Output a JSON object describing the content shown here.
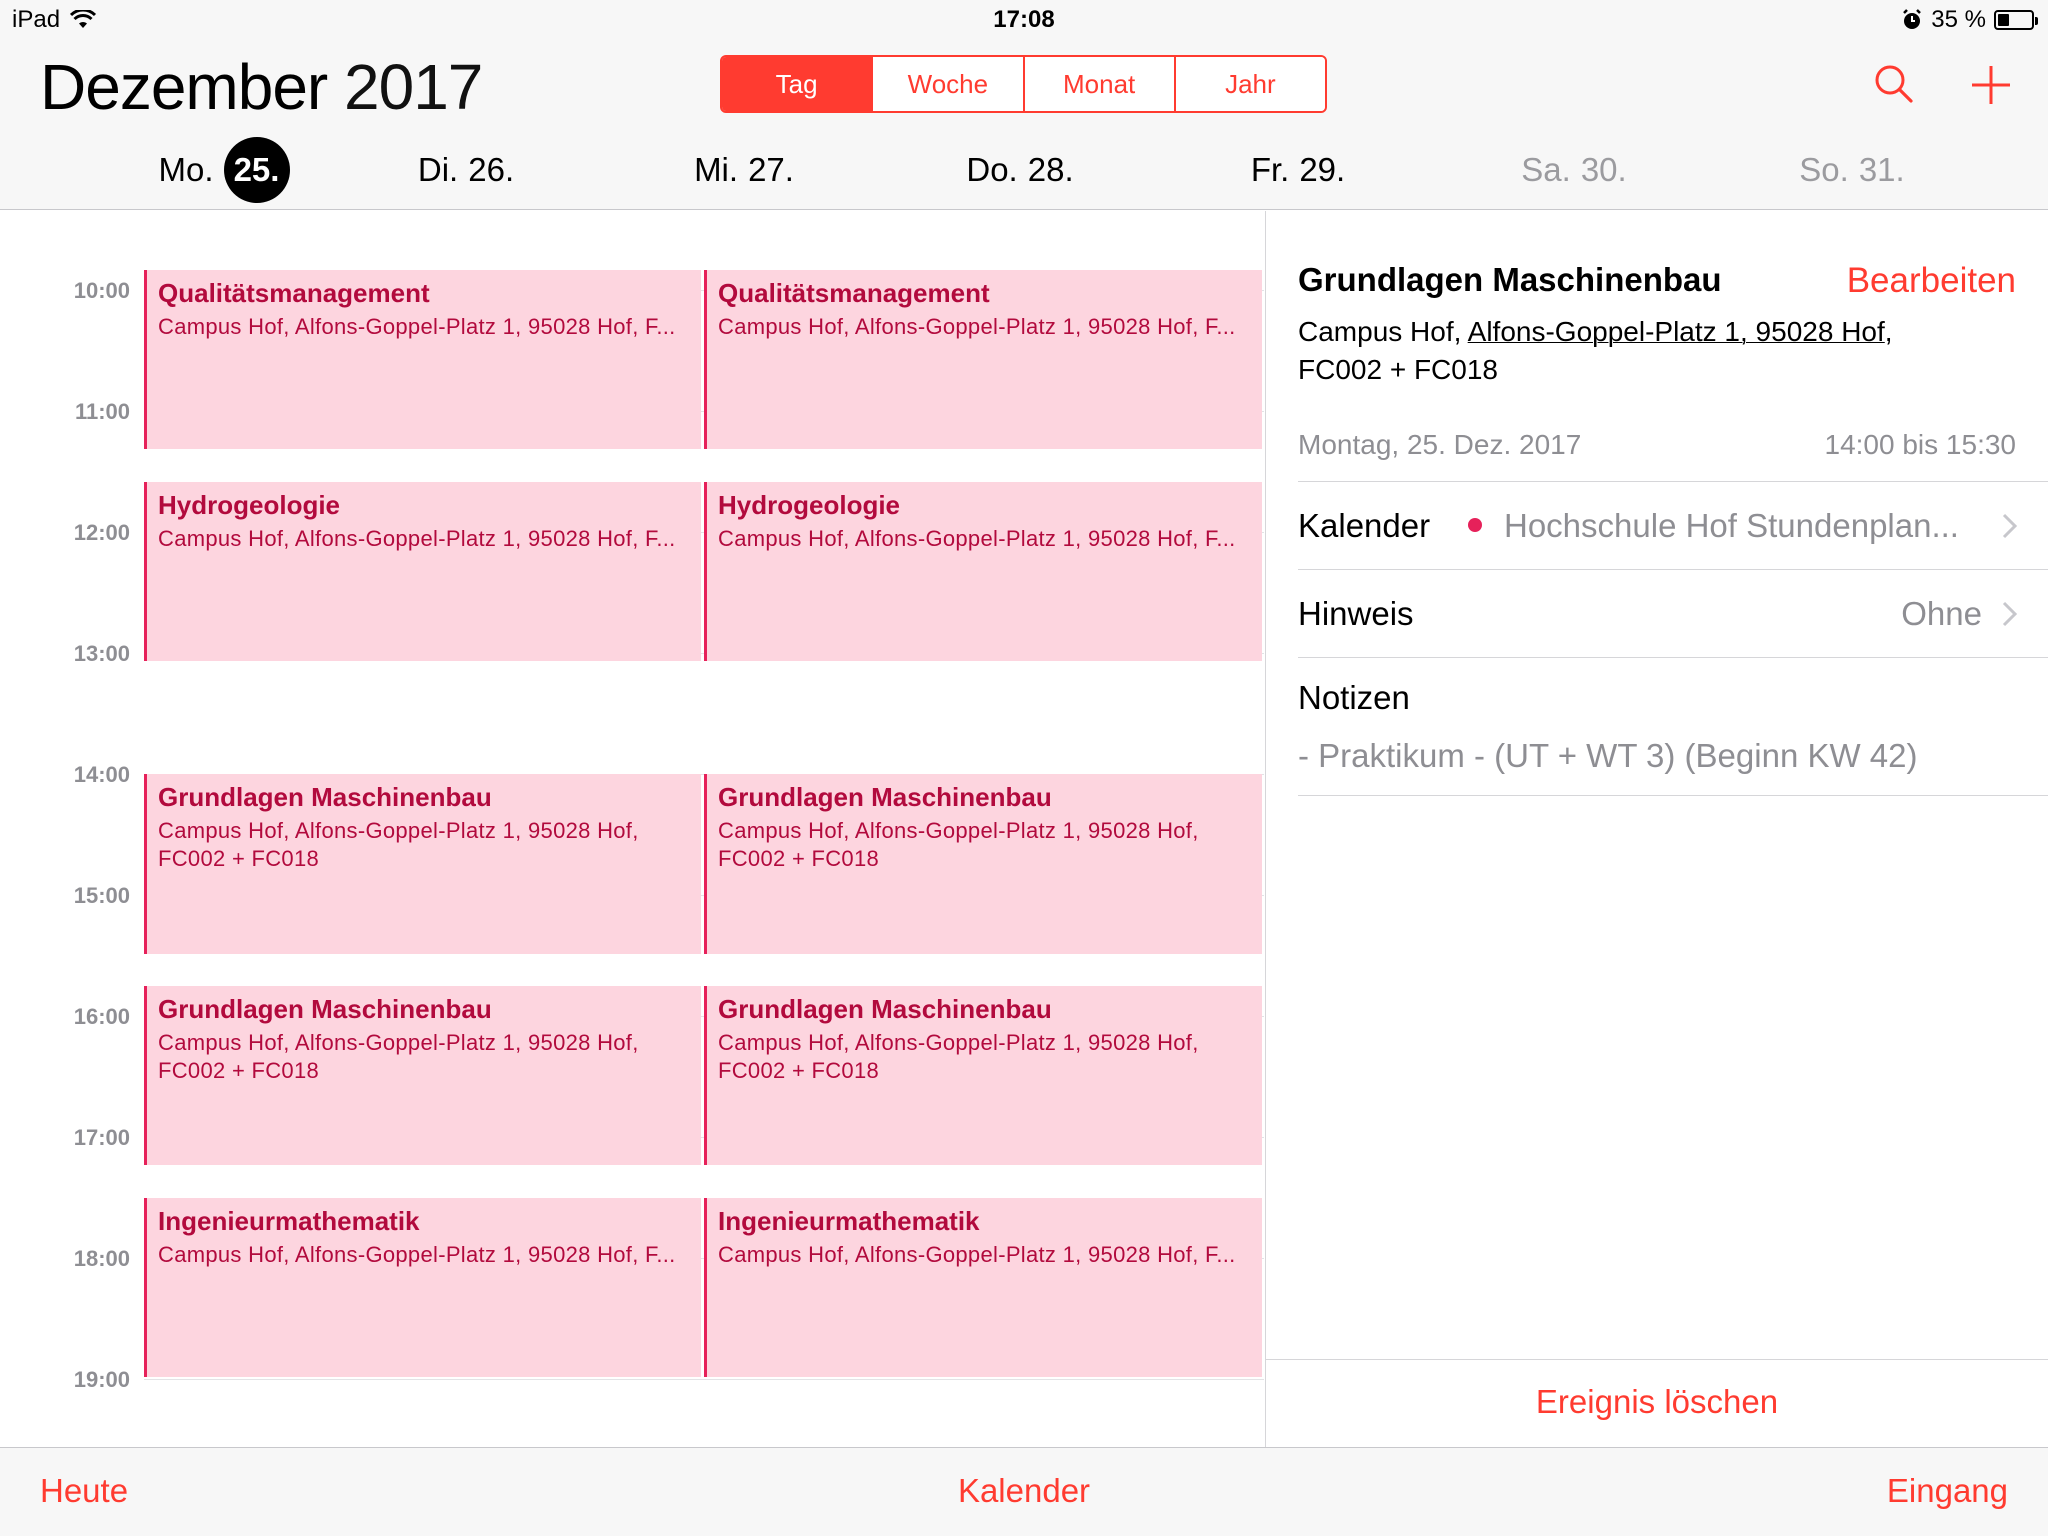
{
  "status_bar": {
    "device": "iPad",
    "time": "17:08",
    "battery_percent": "35 %",
    "battery_level": 0.35
  },
  "header": {
    "month": "Dezember",
    "year": "2017",
    "view_tabs": [
      {
        "label": "Tag",
        "active": true
      },
      {
        "label": "Woche",
        "active": false
      },
      {
        "label": "Monat",
        "active": false
      },
      {
        "label": "Jahr",
        "active": false
      }
    ],
    "search_icon": "search-icon",
    "add_icon": "plus-icon",
    "days": [
      {
        "weekday": "Mo.",
        "date": "25.",
        "selected": true
      },
      {
        "weekday": "Di.",
        "date": "26.",
        "selected": false
      },
      {
        "weekday": "Mi.",
        "date": "27.",
        "selected": false
      },
      {
        "weekday": "Do.",
        "date": "28.",
        "selected": false
      },
      {
        "weekday": "Fr.",
        "date": "29.",
        "selected": false
      },
      {
        "weekday": "Sa.",
        "date": "30.",
        "selected": false
      },
      {
        "weekday": "So.",
        "date": "31.",
        "selected": false
      }
    ]
  },
  "timeline": {
    "hours": [
      "10:00",
      "11:00",
      "12:00",
      "13:00",
      "14:00",
      "15:00",
      "16:00",
      "17:00",
      "18:00",
      "19:00"
    ],
    "events": [
      {
        "title": "Qualitätsmanagement",
        "location": "Campus Hof, Alfons-Goppel-Platz 1, 95028 Hof, F...",
        "start": "09:50",
        "end": "11:20",
        "column": 0
      },
      {
        "title": "Qualitätsmanagement",
        "location": "Campus Hof, Alfons-Goppel-Platz 1, 95028 Hof, F...",
        "start": "09:50",
        "end": "11:20",
        "column": 1
      },
      {
        "title": "Hydrogeologie",
        "location": "Campus Hof, Alfons-Goppel-Platz 1, 95028 Hof, F...",
        "start": "11:35",
        "end": "13:05",
        "column": 0
      },
      {
        "title": "Hydrogeologie",
        "location": "Campus Hof, Alfons-Goppel-Platz 1, 95028 Hof, F...",
        "start": "11:35",
        "end": "13:05",
        "column": 1
      },
      {
        "title": "Grundlagen Maschinenbau",
        "location_lines": [
          "Campus Hof, Alfons-Goppel-Platz 1, 95028 Hof,",
          "FC002 + FC018"
        ],
        "start": "14:00",
        "end": "15:30",
        "column": 0
      },
      {
        "title": "Grundlagen Maschinenbau",
        "location_lines": [
          "Campus Hof, Alfons-Goppel-Platz 1, 95028 Hof,",
          "FC002 + FC018"
        ],
        "start": "14:00",
        "end": "15:30",
        "column": 1
      },
      {
        "title": "Grundlagen Maschinenbau",
        "location_lines": [
          "Campus Hof, Alfons-Goppel-Platz 1, 95028 Hof,",
          "FC002 + FC018"
        ],
        "start": "15:45",
        "end": "17:15",
        "column": 0
      },
      {
        "title": "Grundlagen Maschinenbau",
        "location_lines": [
          "Campus Hof, Alfons-Goppel-Platz 1, 95028 Hof,",
          "FC002 + FC018"
        ],
        "start": "15:45",
        "end": "17:15",
        "column": 1
      },
      {
        "title": "Ingenieurmathematik",
        "location": "Campus Hof, Alfons-Goppel-Platz 1, 95028 Hof, F...",
        "start": "17:30",
        "end": "19:00",
        "column": 0
      },
      {
        "title": "Ingenieurmathematik",
        "location": "Campus Hof, Alfons-Goppel-Platz 1, 95028 Hof, F...",
        "start": "17:30",
        "end": "19:00",
        "column": 1
      }
    ]
  },
  "detail": {
    "title": "Grundlagen Maschinenbau",
    "edit_label": "Bearbeiten",
    "location_prefix": "Campus Hof, ",
    "location_link": "Alfons-Goppel-Platz 1, 95028 Hof",
    "location_suffix": ",",
    "location_line2": "FC002 + FC018",
    "date": "Montag, 25. Dez. 2017",
    "time": "14:00 bis 15:30",
    "calendar_label": "Kalender",
    "calendar_value": "Hochschule Hof Stundenplan...",
    "calendar_color": "#e6215a",
    "alert_label": "Hinweis",
    "alert_value": "Ohne",
    "notes_label": "Notizen",
    "notes_value": "- Praktikum - (UT + WT 3) (Beginn KW 42)",
    "delete_label": "Ereignis löschen"
  },
  "bottom_bar": {
    "today": "Heute",
    "calendars": "Kalender",
    "inbox": "Eingang"
  },
  "colors": {
    "accent": "#ff3b30",
    "event_bg": "#fdd5df",
    "event_text": "#b20a3d",
    "event_border": "#e6215a"
  }
}
